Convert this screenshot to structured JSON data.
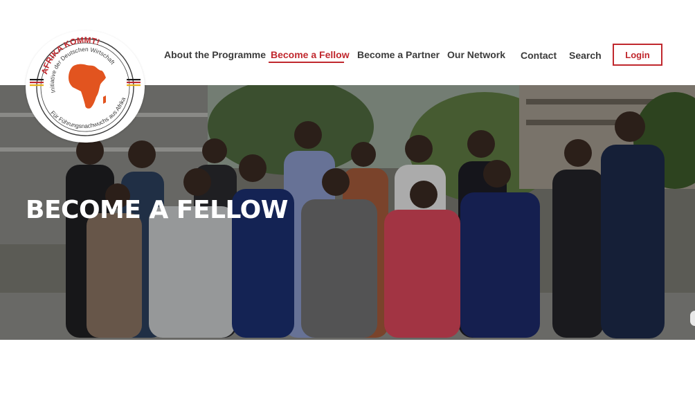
{
  "logo": {
    "top_text": "AFRIKA KOMMT!",
    "inner_text": "Initiative der Deutschen Wirtschaft",
    "bottom_text": "Für Führungsnachwuchs aus Afrika",
    "brand_color": "#c0272d",
    "map_color": "#e2541f"
  },
  "nav": {
    "items": [
      {
        "label": "About the Programme",
        "active": false
      },
      {
        "label": "Become a Fellow",
        "active": true
      },
      {
        "label": "Become a Partner",
        "active": false
      },
      {
        "label": "Our Network",
        "active": false
      },
      {
        "label": "Contact",
        "active": false
      },
      {
        "label": "Search",
        "active": false
      }
    ],
    "login_label": "Login"
  },
  "hero": {
    "title": "BECOME A FELLOW",
    "image_description_icon": "group-photo"
  },
  "colors": {
    "accent": "#c0272d",
    "nav_text": "#3b3b3b"
  }
}
